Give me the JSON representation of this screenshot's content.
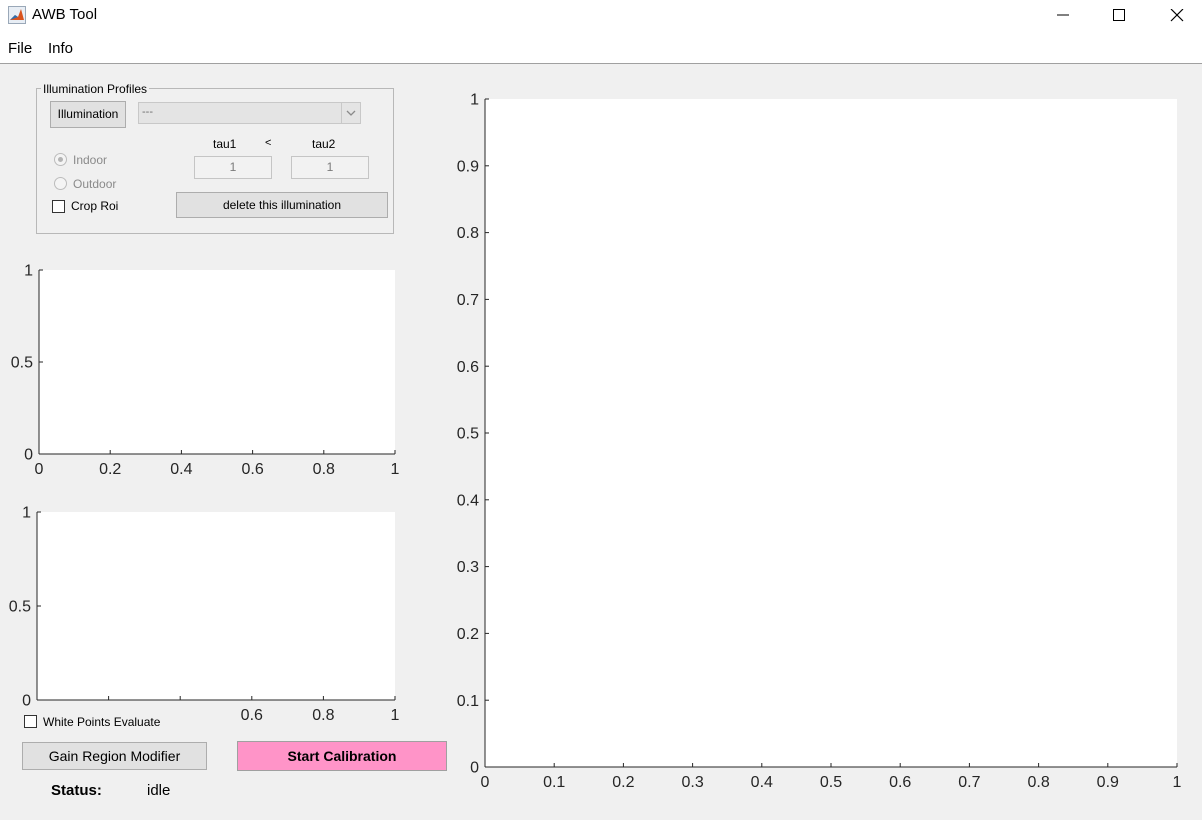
{
  "window": {
    "title": "AWB Tool"
  },
  "menu": {
    "items": [
      "File",
      "Info"
    ]
  },
  "illumination_panel": {
    "title": "Illumination Profiles",
    "illumination_button": "Illumination",
    "dropdown_value": "---",
    "indoor_label": "Indoor",
    "outdoor_label": "Outdoor",
    "indoor_selected": true,
    "crop_roi_label": "Crop Roi",
    "crop_roi_checked": false,
    "tau1_label": "tau1",
    "less_than": "<",
    "tau2_label": "tau2",
    "tau1_value": "1",
    "tau2_value": "1",
    "delete_button": "delete this illumination"
  },
  "controls": {
    "white_points_label": "White Points Evaluate",
    "white_points_checked": false,
    "gain_region_button": "Gain Region Modifier",
    "start_button": "Start Calibration",
    "status_label": "Status:",
    "status_value": "idle"
  },
  "colors": {
    "start_button": "#ff94c8",
    "axes_bg": "#ffffff",
    "window_bg": "#f0f0f0"
  },
  "axes": {
    "top_left": {
      "xticks": [
        "0",
        "0.2",
        "0.4",
        "0.6",
        "0.8",
        "1"
      ],
      "yticks": [
        "0",
        "0.5",
        "1"
      ]
    },
    "bottom_left": {
      "xticks": [
        "0.6",
        "0.8",
        "1"
      ],
      "yticks": [
        "0",
        "0.5",
        "1"
      ]
    },
    "main": {
      "xticks": [
        "0",
        "0.1",
        "0.2",
        "0.3",
        "0.4",
        "0.5",
        "0.6",
        "0.7",
        "0.8",
        "0.9",
        "1"
      ],
      "yticks": [
        "0",
        "0.1",
        "0.2",
        "0.3",
        "0.4",
        "0.5",
        "0.6",
        "0.7",
        "0.8",
        "0.9",
        "1"
      ]
    }
  }
}
